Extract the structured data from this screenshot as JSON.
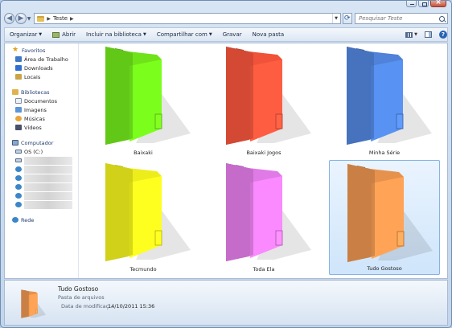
{
  "address": {
    "path": "Teste"
  },
  "search": {
    "placeholder": "Pesquisar Teste"
  },
  "toolbar": {
    "organize": "Organizar",
    "open": "Abrir",
    "include": "Incluir na biblioteca",
    "share": "Compartilhar com",
    "burn": "Gravar",
    "new_folder": "Nova pasta"
  },
  "sidebar": {
    "favorites": "Favoritos",
    "fav_items": [
      "Área de Trabalho",
      "Downloads",
      "Locais"
    ],
    "libraries": "Bibliotecas",
    "lib_items": [
      "Documentos",
      "Imagens",
      "Músicas",
      "Vídeos"
    ],
    "computer": "Computador",
    "comp_items": [
      "OS (C:)"
    ],
    "network": "Rede"
  },
  "folders": [
    {
      "name": "Baixaki",
      "color": "#6fe31a"
    },
    {
      "name": "Baixaki Jogos",
      "color": "#f0533a"
    },
    {
      "name": "Minha Série",
      "color": "#4f82d8"
    },
    {
      "name": "Tecmundo",
      "color": "#eded1c"
    },
    {
      "name": "Toda Ela",
      "color": "#e07ae6"
    },
    {
      "name": "Tudo Gostoso",
      "color": "#e6924d"
    }
  ],
  "details": {
    "name": "Tudo Gostoso",
    "type": "Pasta de arquivos",
    "date_label": "Data de modificaç...",
    "date_value": "14/10/2011 15:36"
  }
}
